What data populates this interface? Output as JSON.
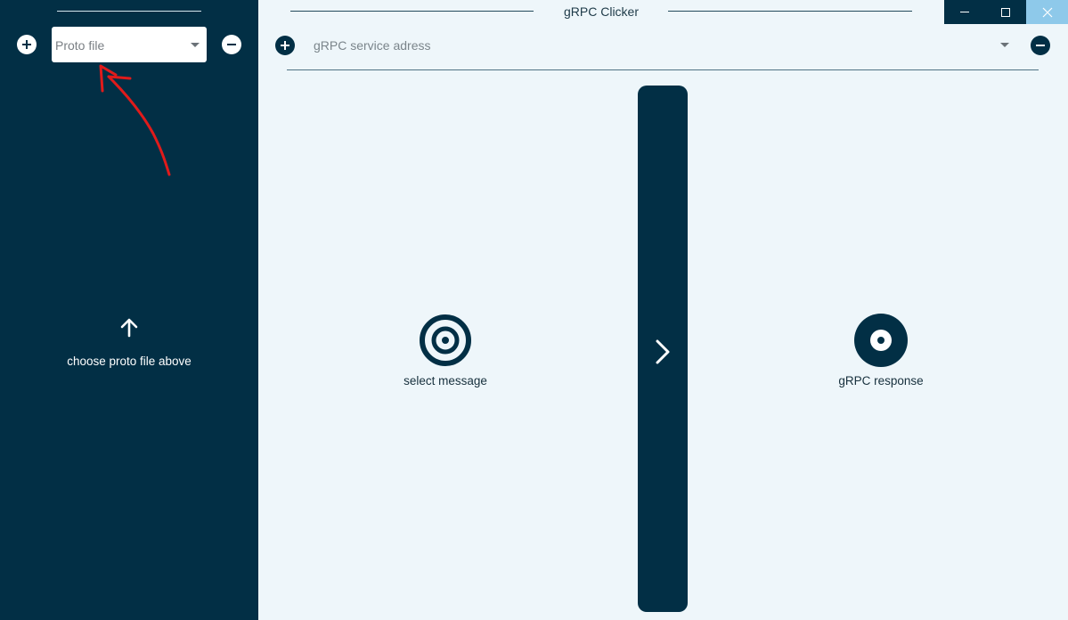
{
  "app": {
    "title": "gRPC Clicker"
  },
  "sidebar": {
    "proto_select": {
      "placeholder": "Proto file"
    },
    "hint": "choose proto file above"
  },
  "service": {
    "placeholder": "gRPC service adress"
  },
  "panes": {
    "request_label": "select message",
    "response_label": "gRPC response"
  },
  "colors": {
    "primary_dark": "#022f45",
    "background": "#eef6fa",
    "close_button": "#8ec9ea",
    "annotation": "#e01b1b"
  },
  "icons": [
    "plus-icon",
    "minus-icon",
    "chevron-down-icon",
    "arrow-up-icon",
    "target-icon",
    "chevron-right-icon",
    "minimize-icon",
    "maximize-icon",
    "close-icon"
  ]
}
